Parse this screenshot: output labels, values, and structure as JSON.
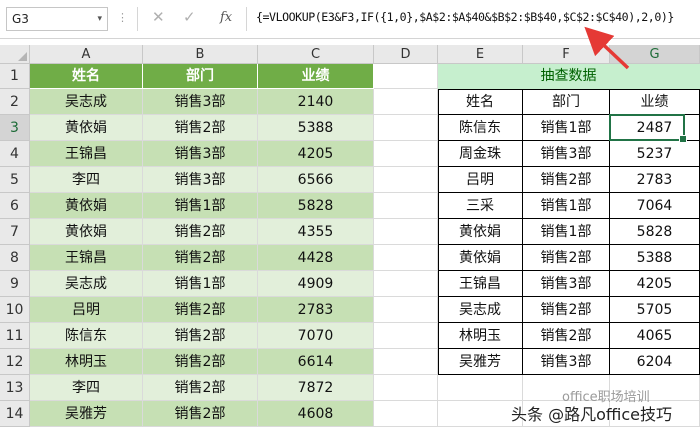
{
  "name_box": "G3",
  "name_box_arrow": "▾",
  "formula_bar": {
    "separator": "⋮",
    "cancel": "✕",
    "enter": "✓",
    "fx": "fx",
    "formula": "{=VLOOKUP(E3&F3,IF({1,0},$A$2:$A$40&$B$2:$B$40,$C$2:$C$40),2,0)}"
  },
  "columns": [
    "A",
    "B",
    "C",
    "D",
    "E",
    "F",
    "G"
  ],
  "rows": [
    "1",
    "2",
    "3",
    "4",
    "5",
    "6",
    "7",
    "8",
    "9",
    "10",
    "11",
    "12",
    "13",
    "14"
  ],
  "active_column": "G",
  "active_row": "3",
  "source_table": {
    "headers": [
      "姓名",
      "部门",
      "业绩"
    ],
    "rows": [
      [
        "吴志成",
        "销售3部",
        "2140"
      ],
      [
        "黄依娟",
        "销售2部",
        "5388"
      ],
      [
        "王锦昌",
        "销售3部",
        "4205"
      ],
      [
        "李四",
        "销售3部",
        "6566"
      ],
      [
        "黄依娟",
        "销售1部",
        "5828"
      ],
      [
        "黄依娟",
        "销售2部",
        "4355"
      ],
      [
        "王锦昌",
        "销售2部",
        "4428"
      ],
      [
        "吴志成",
        "销售1部",
        "4909"
      ],
      [
        "吕明",
        "销售2部",
        "2783"
      ],
      [
        "陈信东",
        "销售2部",
        "7070"
      ],
      [
        "林明玉",
        "销售2部",
        "6614"
      ],
      [
        "李四",
        "销售2部",
        "7872"
      ],
      [
        "吴雅芳",
        "销售2部",
        "4608"
      ]
    ]
  },
  "lookup_table": {
    "title": "抽查数据",
    "headers": [
      "姓名",
      "部门",
      "业绩"
    ],
    "rows": [
      [
        "陈信东",
        "销售1部",
        "2487"
      ],
      [
        "周金珠",
        "销售3部",
        "5237"
      ],
      [
        "吕明",
        "销售2部",
        "2783"
      ],
      [
        "三采",
        "销售1部",
        "7064"
      ],
      [
        "黄依娟",
        "销售1部",
        "5828"
      ],
      [
        "黄依娟",
        "销售2部",
        "5388"
      ],
      [
        "王锦昌",
        "销售3部",
        "4205"
      ],
      [
        "吴志成",
        "销售2部",
        "5705"
      ],
      [
        "林明玉",
        "销售2部",
        "4065"
      ],
      [
        "吴雅芳",
        "销售3部",
        "6204"
      ]
    ]
  },
  "watermark": "office职场培训",
  "caption": "头条 @路凡office技巧",
  "colors": {
    "header_green": "#70ad47",
    "band_dark": "#c6e0b4",
    "band_light": "#e2efda",
    "lookup_title_bg": "#c6efce",
    "lookup_title_text": "#006100",
    "active_cell_border": "#217346",
    "arrow_red": "#e53935"
  }
}
